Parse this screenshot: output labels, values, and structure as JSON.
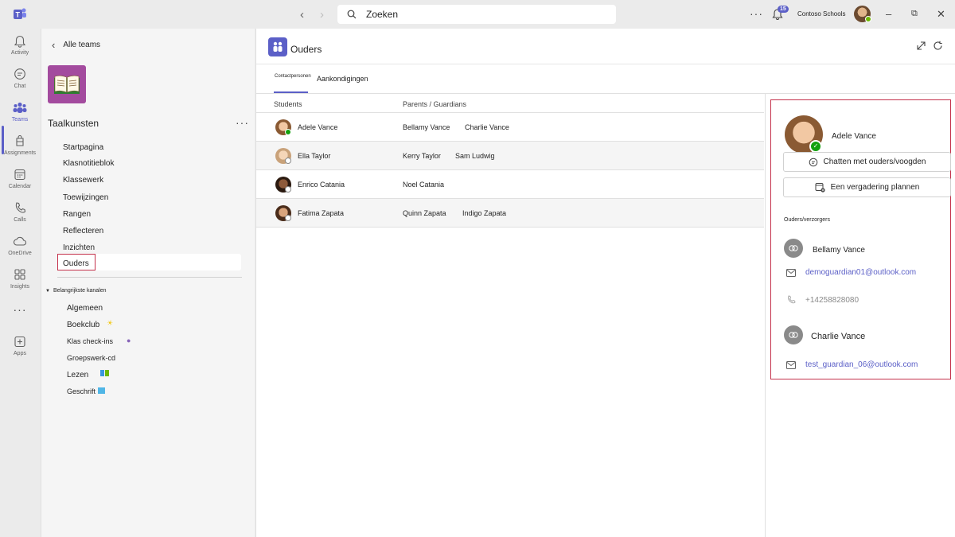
{
  "titlebar": {
    "search_placeholder": "Zoeken",
    "notification_count": "15",
    "org_name": "Contoso Schools"
  },
  "rail": {
    "items": [
      {
        "label": "Activity",
        "icon": "bell-icon"
      },
      {
        "label": "Chat",
        "icon": "chat-icon"
      },
      {
        "label": "Teams",
        "icon": "teams-icon"
      },
      {
        "label": "Assignments",
        "icon": "assignments-icon"
      },
      {
        "label": "Calendar",
        "icon": "calendar-icon"
      },
      {
        "label": "Calls",
        "icon": "phone-icon"
      },
      {
        "label": "OneDrive",
        "icon": "cloud-icon"
      },
      {
        "label": "Insights",
        "icon": "insights-icon"
      },
      {
        "label": "Apps",
        "icon": "add-app-icon"
      }
    ]
  },
  "team": {
    "back_label": "Alle teams",
    "name": "Taalkunsten",
    "nav": [
      "Startpagina",
      "Klasnotitieblok",
      "Klassewerk",
      "Toewijzingen",
      "Rangen",
      "Reflecteren",
      "Inzichten",
      "Ouders"
    ],
    "channels_header": "Belangrijkste kanalen",
    "channels": [
      "Algemeen",
      "Boekclub",
      "Klas check-ins",
      "Groepswerk-cd",
      "Lezen",
      "Geschrift"
    ]
  },
  "app": {
    "title": "Ouders",
    "tabs": [
      "Contactpersonen",
      "Aankondigingen"
    ],
    "columns": [
      "Students",
      "Parents / Guardians"
    ],
    "rows": [
      {
        "student": "Adele Vance",
        "parents": [
          "Bellamy Vance",
          "Charlie Vance"
        ]
      },
      {
        "student": "Ella Taylor",
        "parents": [
          "Kerry Taylor",
          "Sam Ludwig"
        ]
      },
      {
        "student": "Enrico Catania",
        "parents": [
          "Noel Catania",
          ""
        ]
      },
      {
        "student": "Fatima Zapata",
        "parents": [
          "Quinn Zapata",
          "Indigo Zapata"
        ]
      }
    ]
  },
  "details": {
    "student_name": "Adele Vance",
    "chat_button": "Chatten met ouders/voogden",
    "meeting_button": "Een vergadering plannen",
    "section_label": "Ouders/verzorgers",
    "guardians": [
      {
        "name": "Bellamy Vance",
        "email": "demoguardian01@outlook.com",
        "phone": "+14258828080"
      },
      {
        "name": "Charlie Vance",
        "email": "test_guardian_06@outlook.com"
      }
    ]
  },
  "colors": {
    "accent": "#5b5fc7",
    "highlight_border": "#c4314b",
    "team_tile": "#a34b9e"
  }
}
